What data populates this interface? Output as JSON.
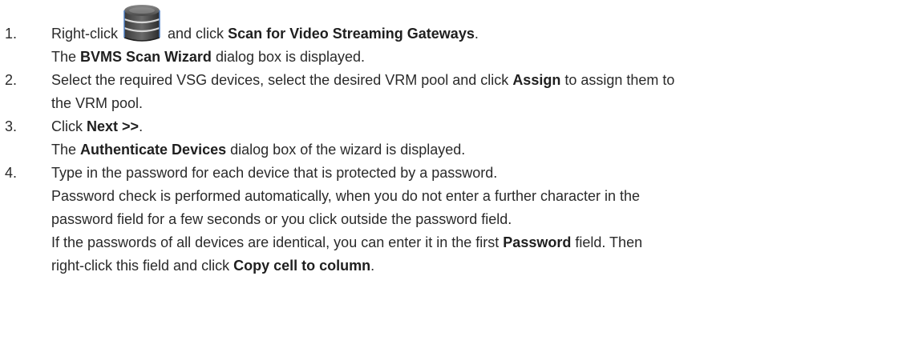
{
  "steps": [
    {
      "num": "1.",
      "line1": {
        "pre": "Right-click",
        "icon": "server-storage-icon",
        "mid": "and click",
        "bold": "Scan for Video Streaming Gateways",
        "post": "."
      },
      "line2": {
        "pre": "The",
        "bold": "BVMS Scan Wizard",
        "post": "dialog box is displayed."
      }
    },
    {
      "num": "2.",
      "line1": {
        "pre": "Select the required VSG devices, select the desired VRM pool and click",
        "bold": "Assign",
        "post": "to assign them to"
      },
      "line2": {
        "text": "the VRM pool."
      }
    },
    {
      "num": "3.",
      "line1": {
        "pre": "Click",
        "bold": "Next >>",
        "post": "."
      },
      "line2": {
        "pre": "The",
        "bold": "Authenticate Devices",
        "post": "dialog box of the wizard is displayed."
      }
    },
    {
      "num": "4.",
      "line1": {
        "text": "Type in the password for each device that is protected by a password."
      },
      "line2": {
        "text": "Password check is performed automatically, when you do not enter a further character in the"
      },
      "line3": {
        "text": "password field for a few seconds or you click outside the password field."
      },
      "line4": {
        "pre": "If the passwords of all devices are identical, you can enter it in the first",
        "bold": "Password",
        "post": "field. Then"
      },
      "line5": {
        "pre": "right-click this field and click",
        "bold": "Copy cell to column",
        "post": "."
      }
    }
  ]
}
